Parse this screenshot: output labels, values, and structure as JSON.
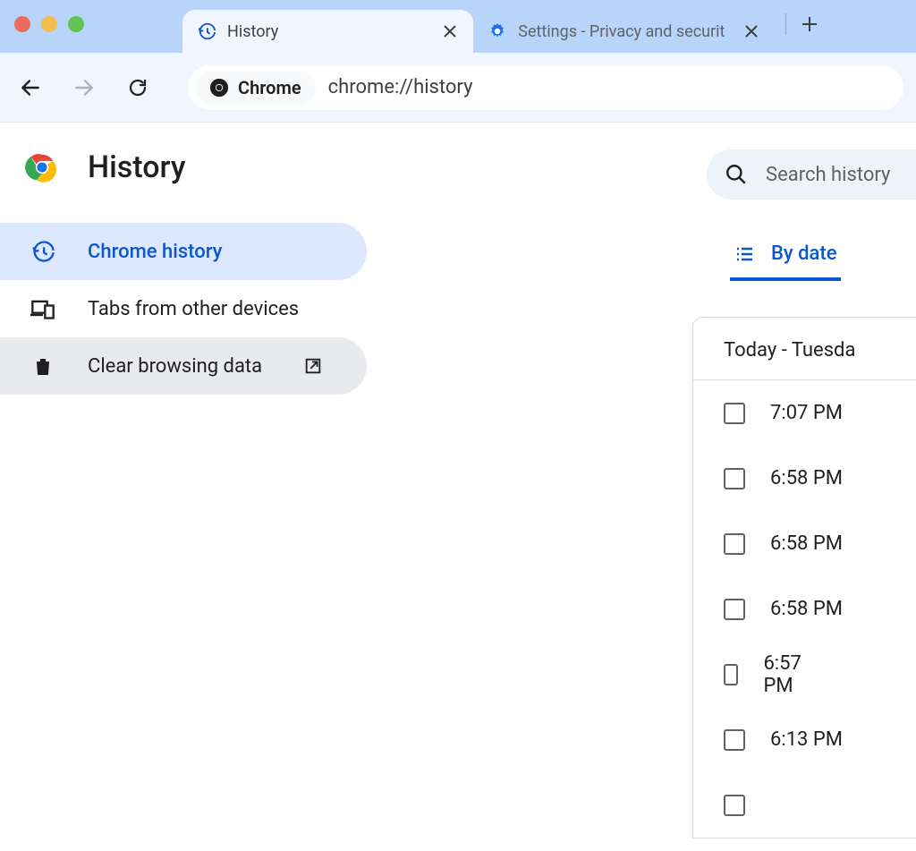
{
  "tabs": {
    "active": {
      "title": "History"
    },
    "inactive": {
      "title": "Settings - Privacy and securit"
    }
  },
  "omnibox": {
    "chip_label": "Chrome",
    "url": "chrome://history"
  },
  "page": {
    "title": "History"
  },
  "sidebar": {
    "items": [
      {
        "label": "Chrome history"
      },
      {
        "label": "Tabs from other devices"
      },
      {
        "label": "Clear browsing data"
      }
    ]
  },
  "search": {
    "placeholder": "Search history"
  },
  "filter": {
    "by_date": "By date"
  },
  "history": {
    "header": "Today - Tuesda",
    "entries": [
      {
        "time": "7:07 PM"
      },
      {
        "time": "6:58 PM"
      },
      {
        "time": "6:58 PM"
      },
      {
        "time": "6:58 PM"
      },
      {
        "time": "6:57 PM"
      },
      {
        "time": "6:13 PM"
      }
    ]
  }
}
